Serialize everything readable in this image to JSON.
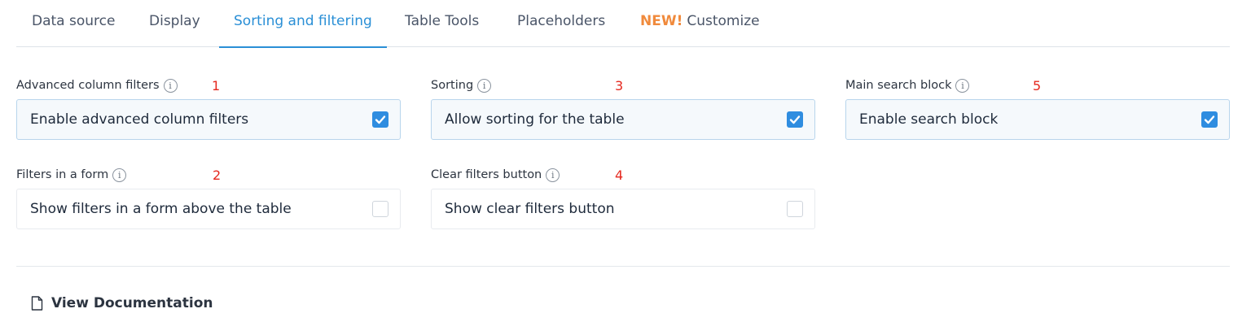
{
  "tabs": [
    {
      "label": "Data source"
    },
    {
      "label": "Display"
    },
    {
      "label": "Sorting and filtering"
    },
    {
      "label": "Table Tools"
    },
    {
      "label": "Placeholders"
    },
    {
      "badge": "NEW!",
      "label": "Customize"
    }
  ],
  "active_tab": "Sorting and filtering",
  "fields": [
    {
      "label": "Advanced column filters",
      "number": "1",
      "option": "Enable advanced column filters",
      "checked": true
    },
    {
      "label": "Filters in a form",
      "number": "2",
      "option": "Show filters in a form above the table",
      "checked": false
    },
    {
      "label": "Sorting",
      "number": "3",
      "option": "Allow sorting for the table",
      "checked": true
    },
    {
      "label": "Clear filters button",
      "number": "4",
      "option": "Show clear filters button",
      "checked": false
    },
    {
      "label": "Main search block",
      "number": "5",
      "option": "Enable search block",
      "checked": true
    }
  ],
  "info_icon": "info-icon",
  "docs": {
    "label": "View Documentation",
    "icon": "file-icon"
  },
  "colors": {
    "accent": "#2a8fd6",
    "new_badge": "#f08a3c",
    "annotation": "#e5281e",
    "checkbox": "#2f8de0"
  }
}
